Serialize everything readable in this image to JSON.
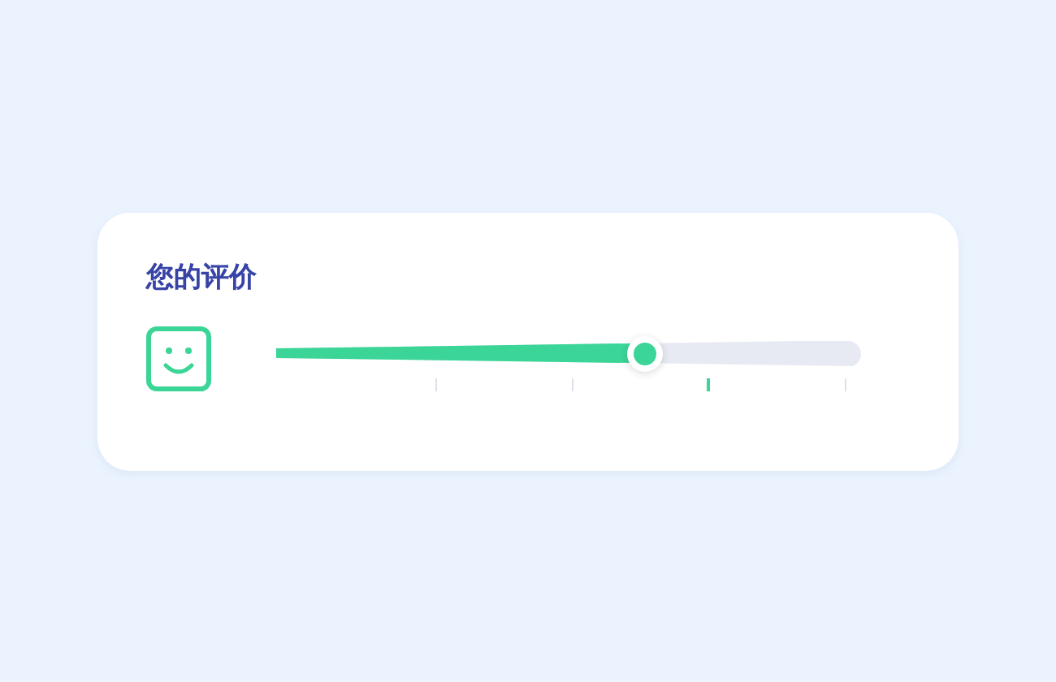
{
  "title": "您的评价",
  "rating": {
    "level": 0.63
  },
  "ticks": [
    {
      "selected": false
    },
    {
      "selected": false
    },
    {
      "selected": true
    },
    {
      "selected": false
    }
  ]
}
